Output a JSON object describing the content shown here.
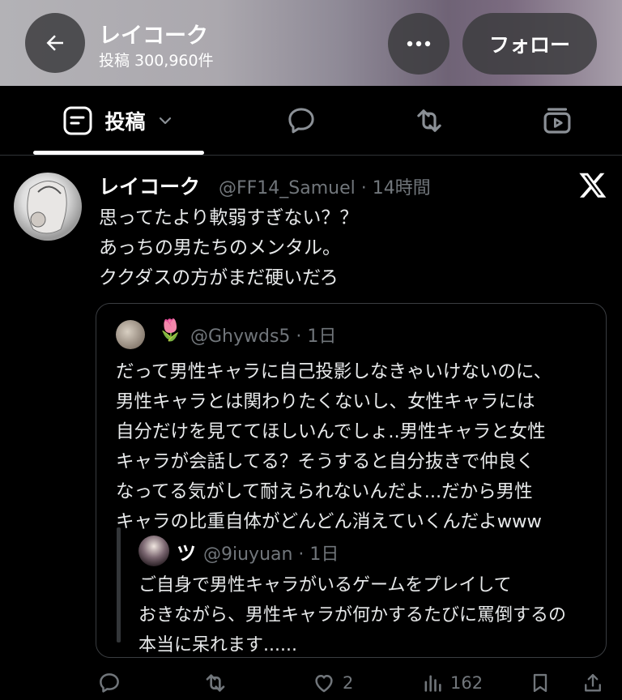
{
  "header": {
    "name": "レイコーク",
    "post_count": "投稿 300,960件",
    "follow_label": "フォロー",
    "back_icon": "arrow-left-icon",
    "more_icon": "more-dots-icon"
  },
  "tabs": {
    "posts_label": "投稿",
    "items": [
      "posts",
      "replies",
      "reposts",
      "media"
    ]
  },
  "tweet": {
    "name": "レイコーク",
    "handle_time": "@FF14_Samuel · 14時間",
    "text": "思ってたより軟弱すぎない？？\nあっちの男たちのメンタル。\nククダスの方がまだ硬いだろ",
    "quote": {
      "emoji": "🌷",
      "handle_time": "@Ghywds5 · 1日",
      "text": "だって男性キャラに自己投影しなきゃいけないのに、\n男性キャラとは関わりたくないし、女性キャラには\n自分だけを見ててほしいんでしょ..男性キャラと女性\nキャラが会話してる？そうすると自分抜きで仲良く\nなってる気がして耐えられないんだよ...だから男性\nキャラの比重自体がどんどん消えていくんだよwww",
      "reply": {
        "name": "ツ",
        "handle_time": "@9iuyuan · 1日",
        "text": "ご自身で男性キャラがいるゲームをプレイして\nおきながら、男性キャラが何かするたびに罵倒するの\n本当に呆れます......"
      }
    },
    "actions": {
      "likes": "2",
      "views": "162"
    }
  },
  "colors": {
    "background": "#000000",
    "text": "#e7e9ea",
    "muted": "#71767b",
    "border": "#2f3336"
  }
}
